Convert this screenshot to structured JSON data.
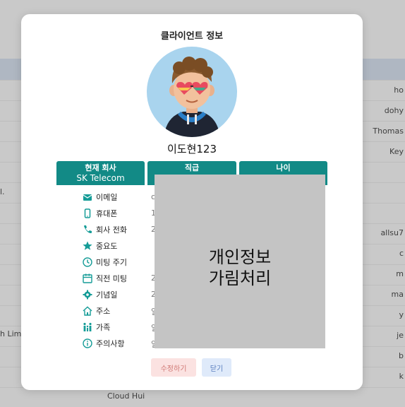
{
  "background": {
    "right_column": [
      "ho",
      "dohy",
      "Thomas",
      "Key",
      "allsu7",
      "c",
      "m",
      "ma",
      "y",
      "je",
      "b",
      "k"
    ],
    "left_column": [
      "l.",
      "h Limi"
    ],
    "bottom_name": "Cloud Hui"
  },
  "modal": {
    "title": "클라이언트 정보",
    "client_name": "이도현123",
    "info_headers": [
      {
        "label": "현재 회사",
        "value": "SK Telecom"
      },
      {
        "label": "직급",
        "value": ""
      },
      {
        "label": "나이",
        "value": ""
      }
    ],
    "rows": [
      {
        "label": "이메일",
        "icon": "mail-icon",
        "value": "c"
      },
      {
        "label": "휴대폰",
        "icon": "phone-icon",
        "value": "1"
      },
      {
        "label": "회사 전화",
        "icon": "call-icon",
        "value": "2"
      },
      {
        "label": "중요도",
        "icon": "star-icon",
        "value": ""
      },
      {
        "label": "미팅 주기",
        "icon": "clock-icon",
        "value": ""
      },
      {
        "label": "직전 미팅",
        "icon": "calendar-icon",
        "value": "2"
      },
      {
        "label": "기념일",
        "icon": "gear-icon",
        "value": "2"
      },
      {
        "label": "주소",
        "icon": "home-icon",
        "value": "일"
      },
      {
        "label": "가족",
        "icon": "family-icon",
        "value": "일"
      },
      {
        "label": "주의사항",
        "icon": "info-icon",
        "value": "일"
      }
    ],
    "mask_line1": "개인정보",
    "mask_line2": "가림처리",
    "edit_button": "수정하기",
    "close_button": "닫기"
  },
  "colors": {
    "accent": "#128a86",
    "edit_bg": "#fbe2e1",
    "close_bg": "#dfeafa"
  }
}
